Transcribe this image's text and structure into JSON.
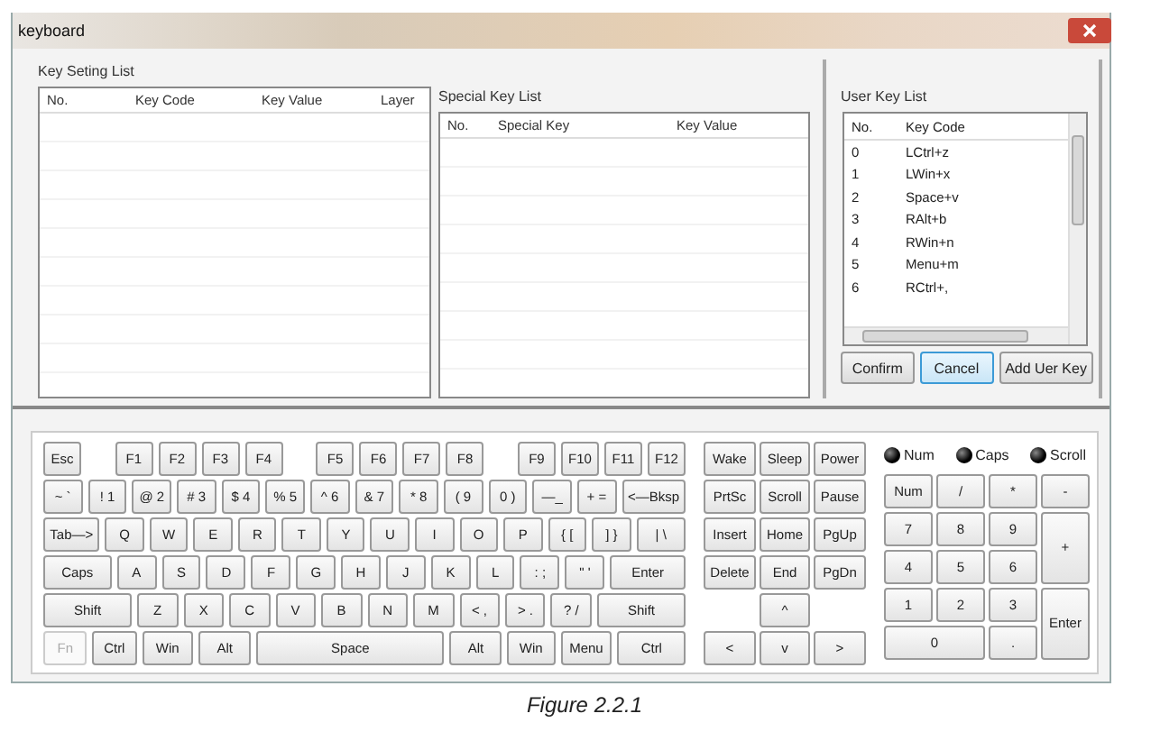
{
  "window": {
    "title": "keyboard"
  },
  "key_setting_list": {
    "title": "Key Seting List",
    "columns": [
      "No.",
      "Key Code",
      "Key Value",
      "Layer"
    ]
  },
  "special_key_list": {
    "title": "Special Key List",
    "columns": [
      "No.",
      "Special Key",
      "Key Value"
    ]
  },
  "user_key_list": {
    "title": "User Key List",
    "columns": [
      "No.",
      "Key Code"
    ],
    "rows": [
      {
        "no": "0",
        "key_code": "LCtrl+z"
      },
      {
        "no": "1",
        "key_code": "LWin+x"
      },
      {
        "no": "2",
        "key_code": "Space+v"
      },
      {
        "no": "3",
        "key_code": "RAlt+b"
      },
      {
        "no": "4",
        "key_code": "RWin+n"
      },
      {
        "no": "5",
        "key_code": "Menu+m"
      },
      {
        "no": "6",
        "key_code": "RCtrl+,"
      }
    ]
  },
  "buttons": [
    {
      "label": "Confirm",
      "focused": false
    },
    {
      "label": "Cancel",
      "focused": true
    },
    {
      "label": "Add Uer Key",
      "focused": false
    }
  ],
  "main_keys": [
    [
      {
        "label": "Esc",
        "disabled": false
      },
      {
        "label": "F1",
        "disabled": false
      },
      {
        "label": "F2",
        "disabled": false
      },
      {
        "label": "F3",
        "disabled": false
      },
      {
        "label": "F4",
        "disabled": false
      },
      {
        "label": "F5",
        "disabled": false
      },
      {
        "label": "F6",
        "disabled": false
      },
      {
        "label": "F7",
        "disabled": false
      },
      {
        "label": "F8",
        "disabled": false
      },
      {
        "label": "F9",
        "disabled": false
      },
      {
        "label": "F10",
        "disabled": false
      },
      {
        "label": "F11",
        "disabled": false
      },
      {
        "label": "F12",
        "disabled": false
      }
    ],
    [
      {
        "label": "~ `",
        "disabled": false
      },
      {
        "label": "! 1",
        "disabled": false
      },
      {
        "label": "@ 2",
        "disabled": false
      },
      {
        "label": "# 3",
        "disabled": false
      },
      {
        "label": "$ 4",
        "disabled": false
      },
      {
        "label": "% 5",
        "disabled": false
      },
      {
        "label": "^ 6",
        "disabled": false
      },
      {
        "label": "& 7",
        "disabled": false
      },
      {
        "label": "* 8",
        "disabled": false
      },
      {
        "label": "( 9",
        "disabled": false
      },
      {
        "label": "0 )",
        "disabled": false
      },
      {
        "label": "—_",
        "disabled": false
      },
      {
        "label": "+ =",
        "disabled": false
      },
      {
        "label": "<—Bksp",
        "disabled": false
      }
    ],
    [
      {
        "label": "Tab—>",
        "disabled": false
      },
      {
        "label": "Q",
        "disabled": false
      },
      {
        "label": "W",
        "disabled": false
      },
      {
        "label": "E",
        "disabled": false
      },
      {
        "label": "R",
        "disabled": false
      },
      {
        "label": "T",
        "disabled": false
      },
      {
        "label": "Y",
        "disabled": false
      },
      {
        "label": "U",
        "disabled": false
      },
      {
        "label": "I",
        "disabled": false
      },
      {
        "label": "O",
        "disabled": false
      },
      {
        "label": "P",
        "disabled": false
      },
      {
        "label": "{ [",
        "disabled": false
      },
      {
        "label": "] }",
        "disabled": false
      },
      {
        "label": "| \\",
        "disabled": false
      }
    ],
    [
      {
        "label": "Caps",
        "disabled": false
      },
      {
        "label": "A",
        "disabled": false
      },
      {
        "label": "S",
        "disabled": false
      },
      {
        "label": "D",
        "disabled": false
      },
      {
        "label": "F",
        "disabled": false
      },
      {
        "label": "G",
        "disabled": false
      },
      {
        "label": "H",
        "disabled": false
      },
      {
        "label": "J",
        "disabled": false
      },
      {
        "label": "K",
        "disabled": false
      },
      {
        "label": "L",
        "disabled": false
      },
      {
        "label": ": ;",
        "disabled": false
      },
      {
        "label": "\" '",
        "disabled": false
      },
      {
        "label": "Enter",
        "disabled": false
      }
    ],
    [
      {
        "label": "Shift",
        "disabled": false
      },
      {
        "label": "Z",
        "disabled": false
      },
      {
        "label": "X",
        "disabled": false
      },
      {
        "label": "C",
        "disabled": false
      },
      {
        "label": "V",
        "disabled": false
      },
      {
        "label": "B",
        "disabled": false
      },
      {
        "label": "N",
        "disabled": false
      },
      {
        "label": "M",
        "disabled": false
      },
      {
        "label": "< ,",
        "disabled": false
      },
      {
        "label": "> .",
        "disabled": false
      },
      {
        "label": "? /",
        "disabled": false
      },
      {
        "label": "Shift",
        "disabled": false
      }
    ],
    [
      {
        "label": "Fn",
        "disabled": true
      },
      {
        "label": "Ctrl",
        "disabled": false
      },
      {
        "label": "Win",
        "disabled": false
      },
      {
        "label": "Alt",
        "disabled": false
      },
      {
        "label": "Space",
        "disabled": false
      },
      {
        "label": "Alt",
        "disabled": false
      },
      {
        "label": "Win",
        "disabled": false
      },
      {
        "label": "Menu",
        "disabled": false
      },
      {
        "label": "Ctrl",
        "disabled": false
      }
    ]
  ],
  "nav_keys": [
    [
      "Wake",
      "Sleep",
      "Power"
    ],
    [
      "PrtSc",
      "Scroll",
      "Pause"
    ],
    [
      "Insert",
      "Home",
      "PgUp"
    ],
    [
      "Delete",
      "End",
      "PgDn"
    ],
    [
      "^"
    ],
    [
      "<",
      "v",
      ">"
    ]
  ],
  "indicators": [
    {
      "label": "Num",
      "on": false
    },
    {
      "label": "Caps",
      "on": false
    },
    {
      "label": "Scroll",
      "on": false
    }
  ],
  "numpad": [
    {
      "label": "Num",
      "kind": "normal"
    },
    {
      "label": "/",
      "kind": "normal"
    },
    {
      "label": "*",
      "kind": "normal"
    },
    {
      "label": "-",
      "kind": "normal"
    },
    {
      "label": "7",
      "kind": "normal"
    },
    {
      "label": "8",
      "kind": "normal"
    },
    {
      "label": "9",
      "kind": "normal"
    },
    {
      "label": "+",
      "kind": "tall"
    },
    {
      "label": "4",
      "kind": "normal"
    },
    {
      "label": "5",
      "kind": "normal"
    },
    {
      "label": "6",
      "kind": "normal"
    },
    {
      "label": "1",
      "kind": "normal"
    },
    {
      "label": "2",
      "kind": "normal"
    },
    {
      "label": "3",
      "kind": "normal"
    },
    {
      "label": "Enter",
      "kind": "tall"
    },
    {
      "label": "0",
      "kind": "wide"
    },
    {
      "label": ".",
      "kind": "normal"
    }
  ],
  "caption": "Figure 2.2.1"
}
